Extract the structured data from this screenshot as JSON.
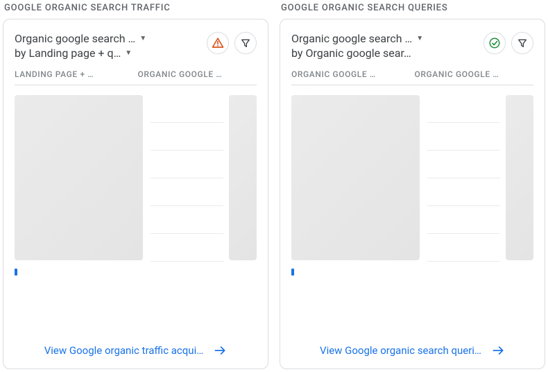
{
  "panels": [
    {
      "title": "GOOGLE ORGANIC SEARCH TRAFFIC",
      "metric": "Organic google search …",
      "dimension": "by Landing page + q…",
      "col1": "LANDING PAGE + …",
      "col2": "ORGANIC GOOGLE …",
      "footer": "View Google organic traffic acqui…",
      "status": "warning"
    },
    {
      "title": "GOOGLE ORGANIC SEARCH QUERIES",
      "metric": "Organic google search …",
      "dimension": "by Organic google sear…",
      "col1": "ORGANIC GOOGLE …",
      "col2": "ORGANIC GOOGLE …",
      "footer": "View Google organic search queri…",
      "status": "success"
    }
  ]
}
